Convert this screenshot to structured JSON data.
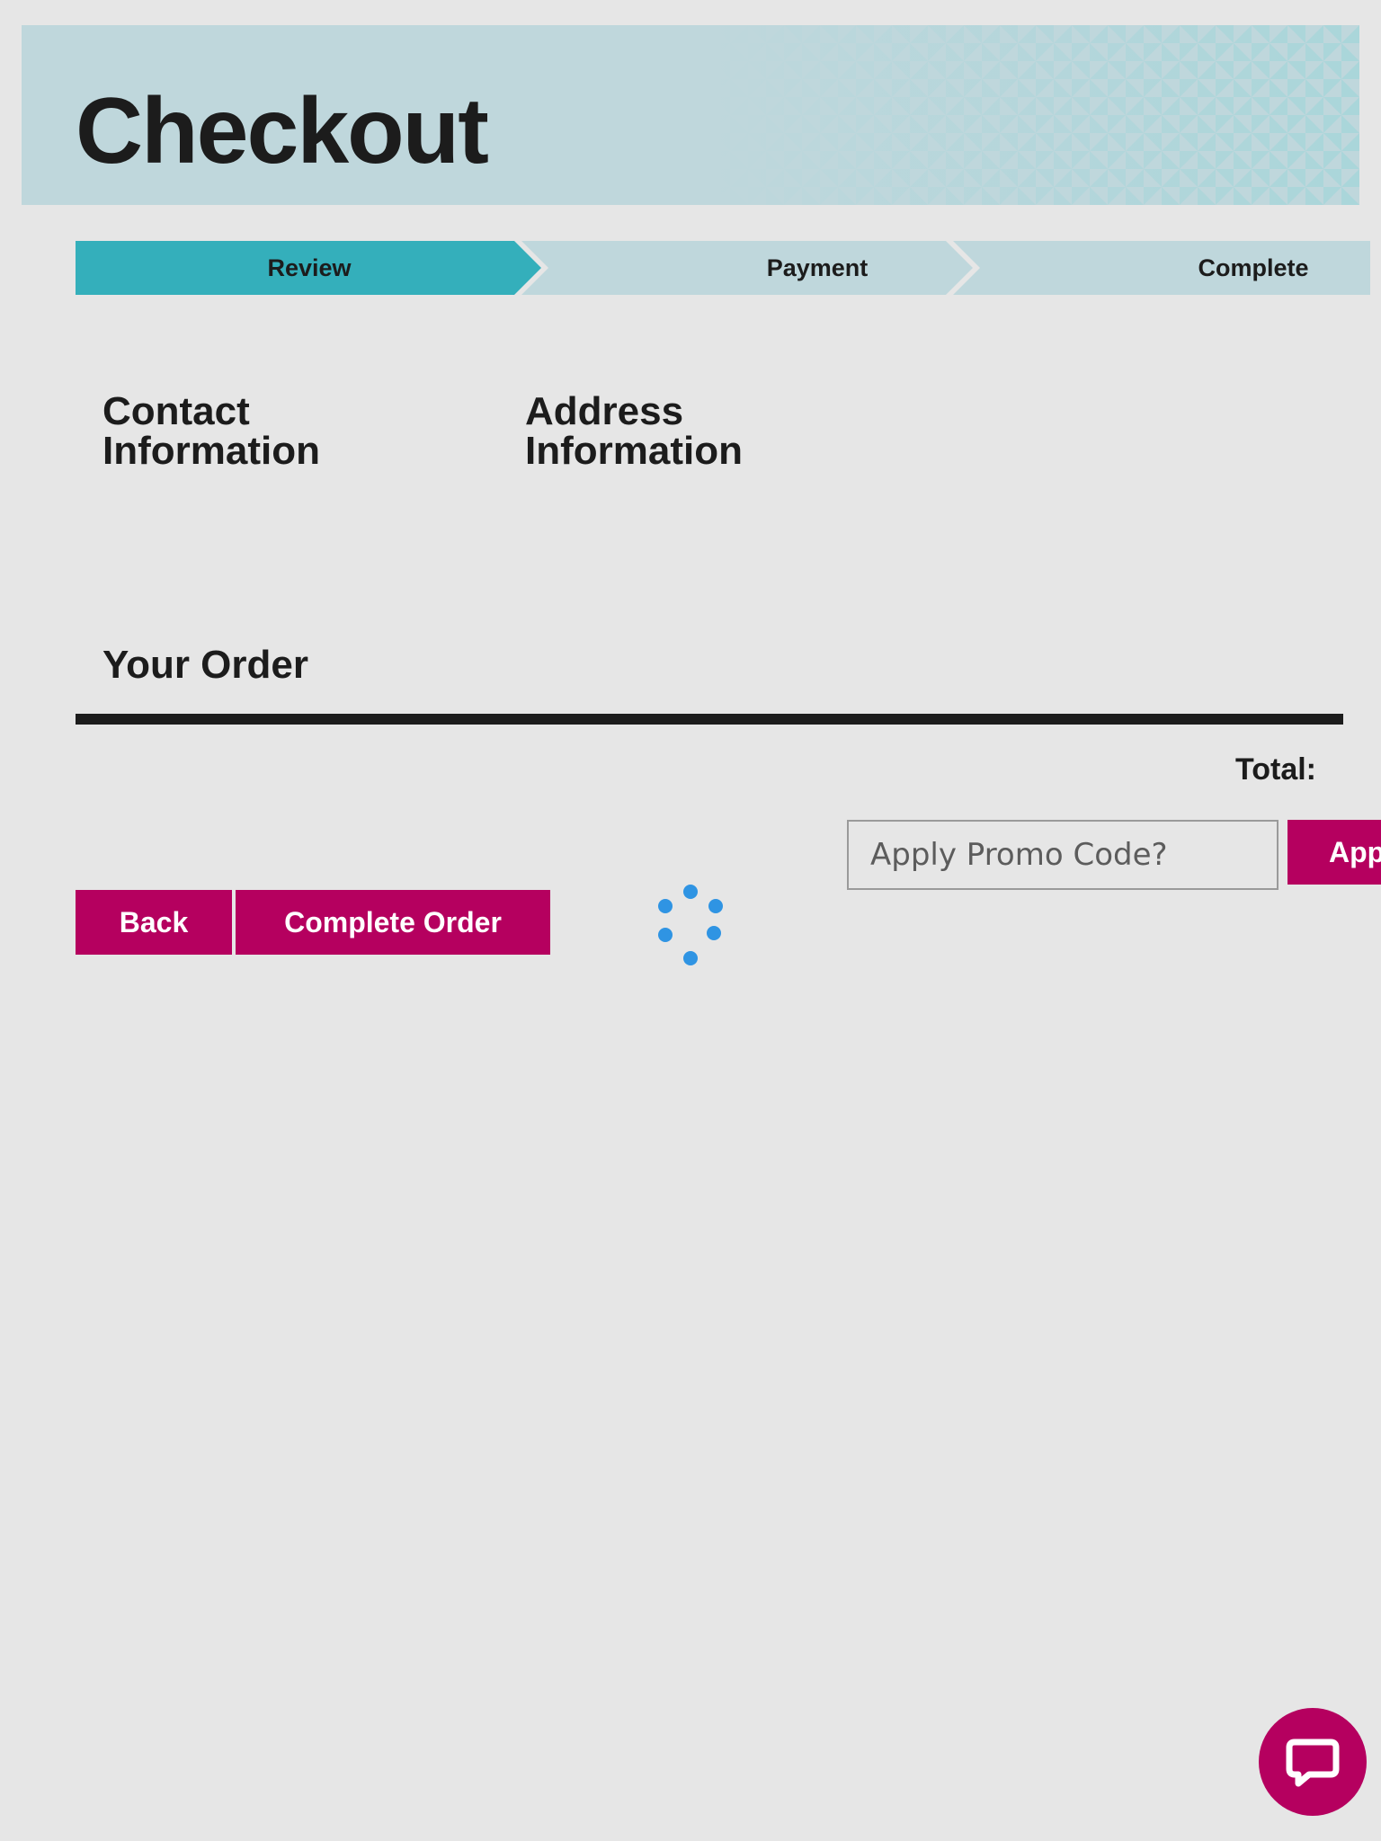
{
  "header": {
    "title": "Checkout"
  },
  "steps": [
    {
      "label": "Review",
      "active": true
    },
    {
      "label": "Payment",
      "active": false
    },
    {
      "label": "Complete",
      "active": false
    }
  ],
  "sections": {
    "contact_heading_line1": "Contact",
    "contact_heading_line2": "Information",
    "address_heading_line1": "Address",
    "address_heading_line2": "Information",
    "order_heading": "Your Order"
  },
  "order": {
    "total_label": "Total:"
  },
  "promo": {
    "placeholder": "Apply Promo Code?",
    "apply_label": "Apply"
  },
  "actions": {
    "back_label": "Back",
    "complete_label": "Complete Order"
  },
  "icons": {
    "spinner": "loading-spinner-icon",
    "chat": "chat-bubble-icon"
  },
  "colors": {
    "accent": "#b5005f",
    "step_active": "#34afbb",
    "step_inactive": "#bfd7dc",
    "spinner": "#2f94e3",
    "background": "#e6e6e6"
  }
}
